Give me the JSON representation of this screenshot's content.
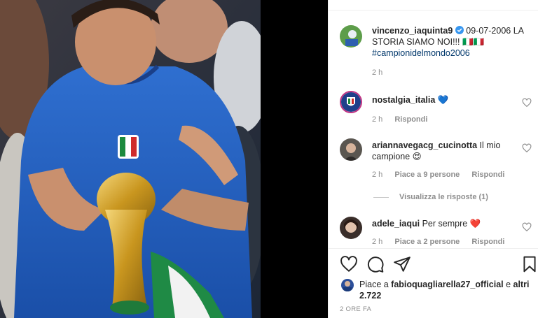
{
  "post": {
    "author": "vincenzo_iaquinta9",
    "caption_text": "09-07-2006 LA STORIA SIAMO NOI!!! 🇮🇹🇮🇹",
    "hashtag": "#campionidelmondo2006",
    "time": "2 h",
    "verified_icon": "verified-badge-icon"
  },
  "comments": [
    {
      "user": "nostalgia_italia",
      "text": "💙",
      "time": "2 h",
      "reply_label": "Rispondi"
    },
    {
      "user": "ariannavegacg_cucinotta",
      "text": "Il mio campione 😍",
      "time": "2 h",
      "likes_label": "Piace a 9 persone",
      "reply_label": "Rispondi",
      "view_replies_label": "Visualizza le risposte (1)"
    },
    {
      "user": "adele_iaqui",
      "text": "Per sempre ❤️",
      "time": "2 h",
      "likes_label": "Piace a 2 persone",
      "reply_label": "Rispondi"
    }
  ],
  "likes": {
    "prefix": "Piace a ",
    "user": "fabioquagliarella27_official",
    "connector": " e ",
    "others": "altri 2.722"
  },
  "timestamp_caps": "2 ORE FA",
  "icons": {
    "like": "heart-icon",
    "comment": "comment-icon",
    "share": "share-icon",
    "save": "bookmark-icon"
  }
}
